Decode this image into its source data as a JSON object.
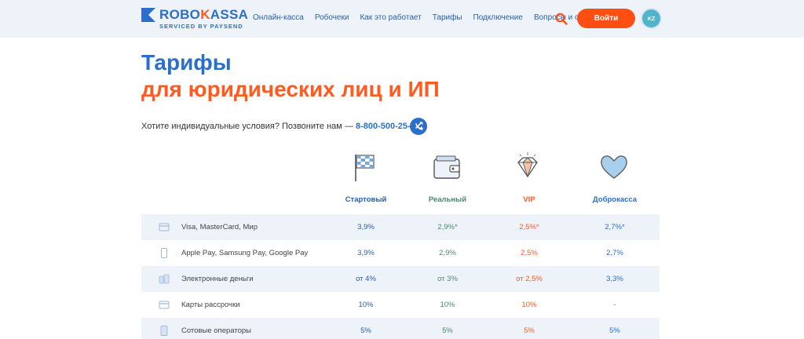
{
  "header": {
    "logo_text_a": "ROBO",
    "logo_text_b": "K",
    "logo_text_c": "ASSA",
    "logo_sub": "SERVICED BY PAYSEND",
    "nav": [
      "Онлайн-касса",
      "Робочеки",
      "Как это работает",
      "Тарифы",
      "Подключение",
      "Вопросы и ответы"
    ],
    "login_label": "Войти",
    "region_label": "KZ"
  },
  "page": {
    "title_line1": "Тарифы",
    "title_line2": "для юридических лиц и ИП",
    "contact_text": "Хотите индивидуальные условия? Позвоните нам — ",
    "phone": "8-800-500-25-57"
  },
  "plans": [
    {
      "name": "Стартовый",
      "icon": "checkered-flag-icon",
      "color": "#2a5ea8"
    },
    {
      "name": "Реальный",
      "icon": "wallet-icon",
      "color": "#4a8a6a"
    },
    {
      "name": "VIP",
      "icon": "diamond-icon",
      "color": "#ff5a1f"
    },
    {
      "name": "Доброкасса",
      "icon": "heart-icon",
      "color": "#2a6fc9"
    }
  ],
  "rows": [
    {
      "label": "Visa, MasterCard, Мир",
      "icon": "card-icon",
      "values": [
        "3,9%",
        "2,9%*",
        "2,5%*",
        "2,7%*"
      ]
    },
    {
      "label": "Apple Pay, Samsung Pay, Google Pay",
      "icon": "phone-icon",
      "values": [
        "3,9%",
        "2,9%",
        "2,5%",
        "2,7%"
      ]
    },
    {
      "label": "Электронные деньги",
      "icon": "coins-icon",
      "values": [
        "от 4%",
        "от 3%",
        "от 2,5%",
        "3,3%"
      ]
    },
    {
      "label": "Карты рассрочки",
      "icon": "card-icon",
      "values": [
        "10%",
        "10%",
        "10%",
        "-"
      ]
    },
    {
      "label": "Сотовые операторы",
      "icon": "mobile-icon",
      "values": [
        "5%",
        "5%",
        "5%",
        "5%"
      ]
    }
  ],
  "colors": {
    "brand_blue": "#2a6fc9",
    "brand_orange": "#ff5a1f",
    "header_bg": "#eef3fa"
  }
}
